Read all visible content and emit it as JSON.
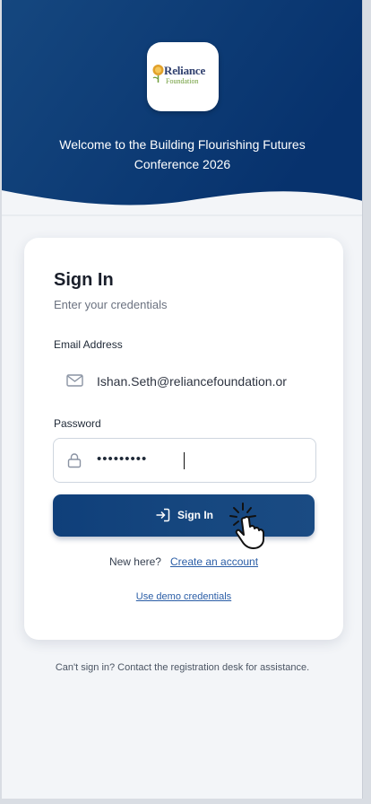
{
  "brand": {
    "logo_name": "Reliance",
    "logo_sub": "Foundation",
    "welcome_line1": "Welcome to the Building Flourishing Futures",
    "welcome_line2": "Conference 2026",
    "header_color": "#0b3a78"
  },
  "card": {
    "title": "Sign In",
    "subtitle": "Enter your credentials",
    "email": {
      "label": "Email Address",
      "value": "Ishan.Seth@reliancefoundation.or",
      "icon": "mail-icon"
    },
    "password": {
      "label": "Password",
      "value": "•••••••••",
      "icon": "lock-icon"
    },
    "signin_button": {
      "label": "Sign In",
      "icon": "sign-in-arrow-icon",
      "color": "#123f7b"
    },
    "new_here": "New here?",
    "create_account": "Create an account",
    "demo_link": "Use demo credentials"
  },
  "footer": {
    "help_text": "Can't sign in? Contact the registration desk for assistance."
  },
  "accent": {
    "link_color": "#2a5da6"
  }
}
